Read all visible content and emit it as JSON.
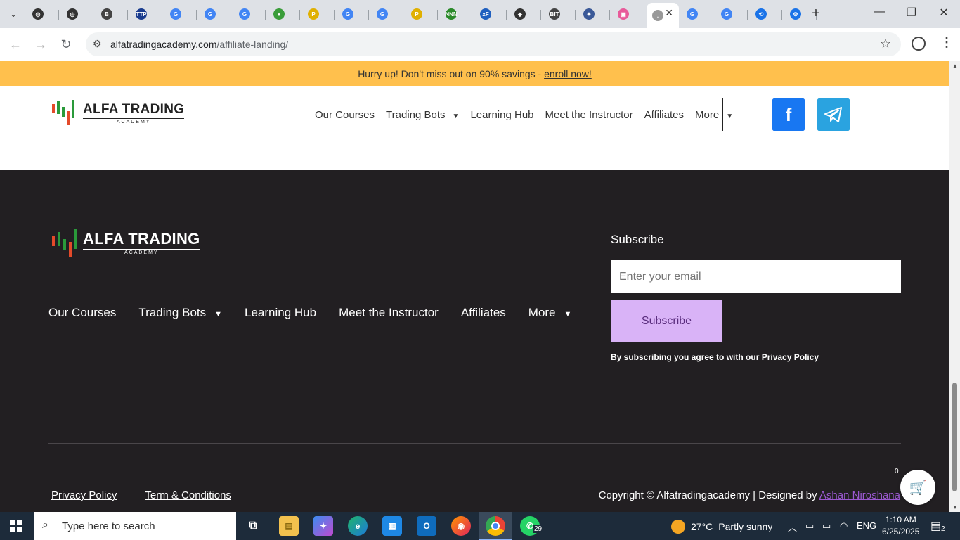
{
  "browser": {
    "tabs": [
      {
        "color": "#333",
        "glyph": "◎"
      },
      {
        "color": "#333",
        "glyph": "◎"
      },
      {
        "color": "#444",
        "glyph": "B"
      },
      {
        "color": "#1a3c8f",
        "glyph": "TTP"
      },
      {
        "color": "#4285f4",
        "glyph": "G"
      },
      {
        "color": "#4285f4",
        "glyph": "G"
      },
      {
        "color": "#4285f4",
        "glyph": "G"
      },
      {
        "color": "#3a9d3a",
        "glyph": "●"
      },
      {
        "color": "#e0b000",
        "glyph": "P"
      },
      {
        "color": "#4285f4",
        "glyph": "G"
      },
      {
        "color": "#4285f4",
        "glyph": "G"
      },
      {
        "color": "#e0b000",
        "glyph": "P"
      },
      {
        "color": "#2a8a2a",
        "glyph": "NNN"
      },
      {
        "color": "#1f5fbf",
        "glyph": "xF"
      },
      {
        "color": "#333",
        "glyph": "◆"
      },
      {
        "color": "#444",
        "glyph": "BIT"
      },
      {
        "color": "#3b5998",
        "glyph": "✦"
      },
      {
        "color": "#e85a9a",
        "glyph": "▣"
      },
      {
        "color": "#999",
        "glyph": "."
      },
      {
        "color": "#4285f4",
        "glyph": "G"
      },
      {
        "color": "#4285f4",
        "glyph": "G"
      },
      {
        "color": "#1a73e8",
        "glyph": "⟲"
      },
      {
        "color": "#1a73e8",
        "glyph": "⚙"
      }
    ],
    "url_host": "alfatradingacademy.com",
    "url_path": "/affiliate-landing/"
  },
  "promo": {
    "text": "Hurry up! Don't miss out on 90% savings - ",
    "link": "enroll now!"
  },
  "logo": {
    "line1": "ALFA TRADING",
    "line2": "ACADEMY"
  },
  "header_nav": [
    "Our Courses",
    "Trading Bots",
    "Learning Hub",
    "Meet the Instructor",
    "Affiliates",
    "More"
  ],
  "social": {
    "facebook_color": "#1877f2",
    "telegram_color": "#2aa3e0"
  },
  "footer": {
    "nav": [
      "Our Courses",
      "Trading Bots",
      "Learning Hub",
      "Meet the Instructor",
      "Affiliates",
      "More"
    ],
    "subscribe_title": "Subscribe",
    "email_placeholder": "Enter your email",
    "subscribe_button": "Subscribe",
    "subscribe_note": "By subscribing you agree to with our Privacy Policy",
    "privacy": "Privacy Policy",
    "terms": "Term & Conditions",
    "copyright": "Copyright © Alfatradingacademy | Designed by ",
    "designer": "Ashan Niroshana",
    "cart_count": "0"
  },
  "taskbar": {
    "search_placeholder": "Type here to search",
    "whatsapp_badge": "29",
    "weather_temp": "27°C",
    "weather_desc": "Partly sunny",
    "lang": "ENG",
    "time": "1:10 AM",
    "date": "6/25/2025",
    "notifications": "2"
  }
}
